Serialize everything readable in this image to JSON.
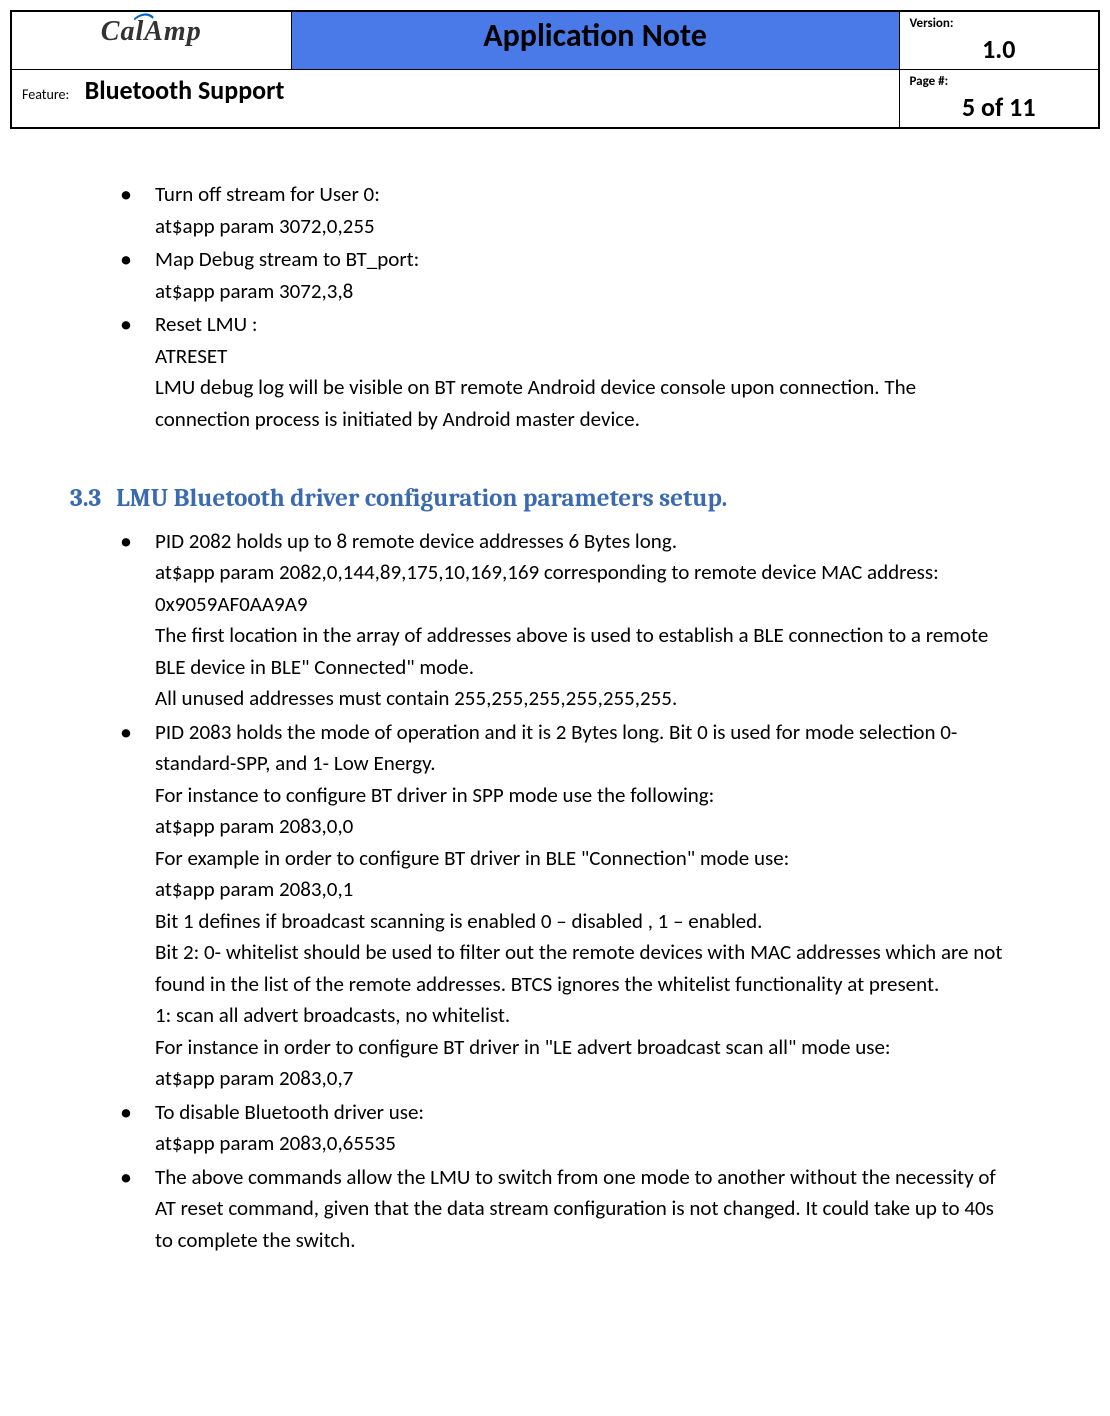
{
  "header": {
    "logo_text": "CalAmp",
    "title": "Application Note",
    "version_label": "Version:",
    "version_value": "1.0",
    "feature_label": "Feature:",
    "feature_value": "Bluetooth Support",
    "page_label": "Page #:",
    "page_value": "5 of 11"
  },
  "top_bullets": [
    "Turn off stream for User 0:\nat$app param 3072,0,255",
    "Map Debug stream to BT_port:\nat$app param 3072,3,8",
    " Reset LMU :\nATRESET\nLMU debug log will be visible on BT remote Android device console upon connection. The connection process is initiated by Android master device."
  ],
  "section": {
    "number": "3.3",
    "title": "LMU Bluetooth driver configuration parameters setup."
  },
  "section_bullets": [
    "PID 2082 holds up to 8  remote device addresses 6 Bytes long.\nat$app param 2082,0,144,89,175,10,169,169 corresponding to remote device MAC address: 0x9059AF0AA9A9\nThe first location in the array of addresses above is used to establish a BLE connection to a remote BLE device in BLE\" Connected\" mode.\nAll unused addresses must contain 255,255,255,255,255,255.",
    "PID 2083 holds the mode of operation and it is 2 Bytes long. Bit 0 is used for mode selection 0- standard-SPP, and 1- Low Energy.\nFor instance to configure BT driver in SPP mode use the following:\nat$app param 2083,0,0\nFor example in order  to configure BT driver in  BLE \"Connection\" mode use:\nat$app param 2083,0,1\nBit 1 defines if broadcast scanning is enabled 0 – disabled , 1 – enabled.\nBit 2: 0- whitelist should be used to filter out the remote devices with MAC addresses which are not found in the list of the remote addresses. BTCS ignores the whitelist functionality at present.\n1: scan all advert broadcasts, no whitelist.\nFor instance in order to configure BT driver in \"LE advert broadcast scan all\" mode use:\nat$app param 2083,0,7",
    "To disable Bluetooth driver use:\nat$app param 2083,0,65535",
    "The above commands allow the LMU to switch from one mode to another without the necessity of AT reset command, given that the data stream configuration is not changed. It could take up to 40s to complete the switch."
  ]
}
